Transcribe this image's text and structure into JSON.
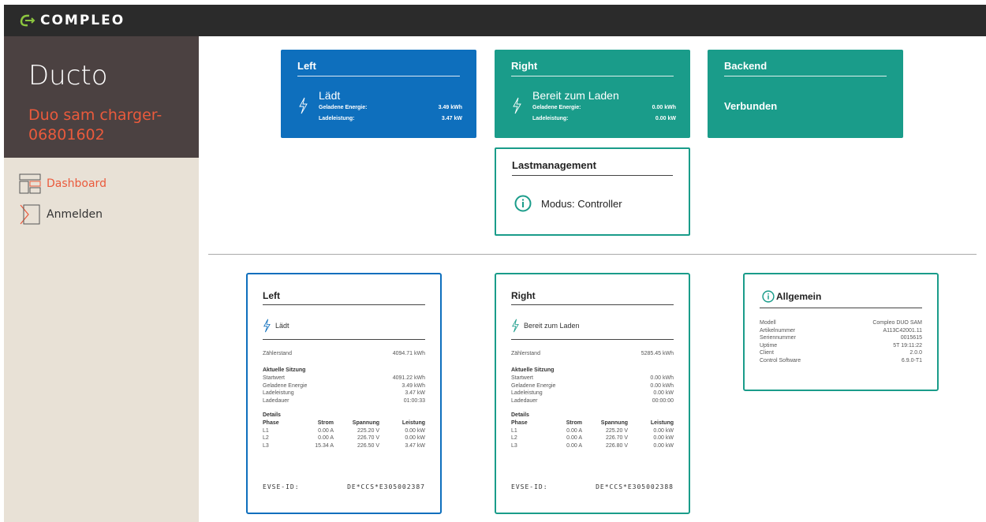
{
  "app": {
    "brand": "COMPLEO"
  },
  "sidebar": {
    "title": "Ducto",
    "subtitle": "Duo sam charger-06801602",
    "items": [
      {
        "label": "Dashboard",
        "icon": "dashboard-icon",
        "active": true
      },
      {
        "label": "Anmelden",
        "icon": "login-icon",
        "active": false
      }
    ]
  },
  "tiles": {
    "left": {
      "title": "Left",
      "status": "Lädt",
      "energy_label": "Geladene Energie:",
      "energy": "3.49 kWh",
      "power_label": "Ladeleistung:",
      "power": "3.47 kW",
      "color": "#0e6fbd"
    },
    "right": {
      "title": "Right",
      "status": "Bereit zum Laden",
      "energy_label": "Geladene Energie:",
      "energy": "0.00 kWh",
      "power_label": "Ladeleistung:",
      "power": "0.00 kW",
      "color": "#1a9c8a"
    },
    "backend": {
      "title": "Backend",
      "status": "Verbunden",
      "color": "#1a9c8a"
    },
    "load": {
      "title": "Lastmanagement",
      "mode": "Modus: Controller"
    }
  },
  "details": {
    "left": {
      "title": "Left",
      "status": "Lädt",
      "meter_label": "Zählerstand",
      "meter": "4094.71 kWh",
      "session_title": "Aktuelle Sitzung",
      "session": [
        {
          "k": "Startwert",
          "v": "4091.22 kWh"
        },
        {
          "k": "Geladene Energie",
          "v": "3.49 kWh"
        },
        {
          "k": "Ladeleistung",
          "v": "3.47 kW"
        },
        {
          "k": "Ladedauer",
          "v": "01:00:33"
        }
      ],
      "details_title": "Details",
      "headers": [
        "Phase",
        "Strom",
        "Spannung",
        "Leistung"
      ],
      "phases": [
        [
          "L1",
          "0.00 A",
          "225.20 V",
          "0.00 kW"
        ],
        [
          "L2",
          "0.00 A",
          "226.70 V",
          "0.00 kW"
        ],
        [
          "L3",
          "15.34 A",
          "226.50 V",
          "3.47 kW"
        ]
      ],
      "evse_label": "EVSE-ID:",
      "evse": "DE*CCS*E305002387"
    },
    "right": {
      "title": "Right",
      "status": "Bereit zum Laden",
      "meter_label": "Zählerstand",
      "meter": "5285.45 kWh",
      "session_title": "Aktuelle Sitzung",
      "session": [
        {
          "k": "Startwert",
          "v": "0.00 kWh"
        },
        {
          "k": "Geladene Energie",
          "v": "0.00 kWh"
        },
        {
          "k": "Ladeleistung",
          "v": "0.00 kW"
        },
        {
          "k": "Ladedauer",
          "v": "00:00:00"
        }
      ],
      "details_title": "Details",
      "headers": [
        "Phase",
        "Strom",
        "Spannung",
        "Leistung"
      ],
      "phases": [
        [
          "L1",
          "0.00 A",
          "225.20 V",
          "0.00 kW"
        ],
        [
          "L2",
          "0.00 A",
          "226.70 V",
          "0.00 kW"
        ],
        [
          "L3",
          "0.00 A",
          "226.80 V",
          "0.00 kW"
        ]
      ],
      "evse_label": "EVSE-ID:",
      "evse": "DE*CCS*E305002388"
    }
  },
  "general": {
    "title": "Allgemein",
    "rows": [
      {
        "k": "Modell",
        "v": "Compleo DUO SAM"
      },
      {
        "k": "Artikelnummer",
        "v": "A113C42001.11"
      },
      {
        "k": "Seriennummer",
        "v": "0015615"
      },
      {
        "k": "Uptime",
        "v": "5T 19:11:22"
      },
      {
        "k": "Client",
        "v": "2.0.0"
      },
      {
        "k": "Control Software",
        "v": "6.9.0-T1"
      }
    ]
  }
}
